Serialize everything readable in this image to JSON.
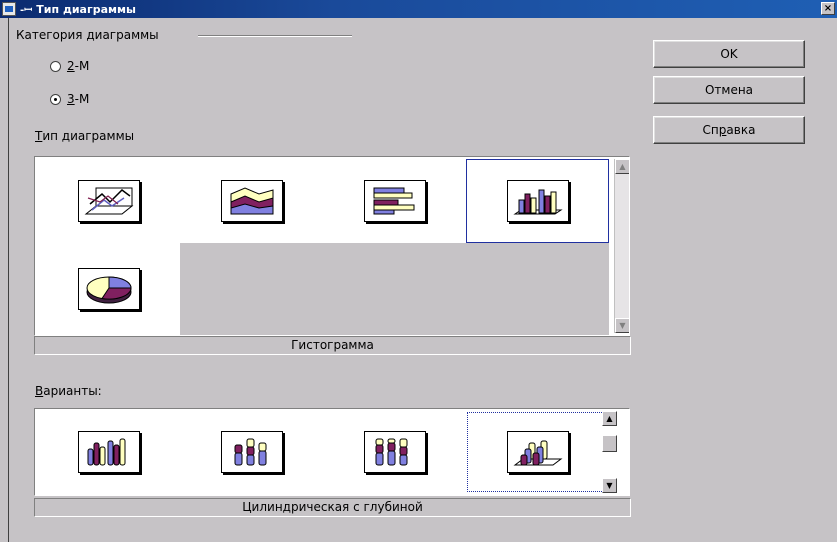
{
  "window": {
    "title": "Тип диаграммы",
    "title_dash": "-ꟷ",
    "close_glyph": "×"
  },
  "category": {
    "label": "Категория диаграммы",
    "options": [
      {
        "hotkey": "2",
        "rest": "-М",
        "checked": false
      },
      {
        "hotkey": "3",
        "rest": "-М",
        "checked": true
      }
    ]
  },
  "chart_type": {
    "label_hotkey": "Т",
    "label_rest": "ип диаграммы",
    "icons": [
      "3d-line-chart-icon",
      "3d-area-chart-icon",
      "3d-bar-chart-icon",
      "3d-column-chart-icon",
      "3d-pie-chart-icon"
    ],
    "selected_index": 3,
    "caption": "Гистограмма"
  },
  "variants": {
    "label_hotkey": "В",
    "label_rest": "арианты:",
    "icons": [
      "cylinder-clustered-icon",
      "cylinder-stacked-icon",
      "cylinder-percent-icon",
      "cylinder-3d-depth-icon"
    ],
    "selected_index": 3,
    "caption": "Цилиндрическая с глубиной"
  },
  "buttons": {
    "ok": "OK",
    "cancel": "Отмена",
    "help_pre": "Сп",
    "help_hotkey": "р",
    "help_post": "авка"
  },
  "scroll_glyphs": {
    "up": "▲",
    "down": "▼"
  }
}
